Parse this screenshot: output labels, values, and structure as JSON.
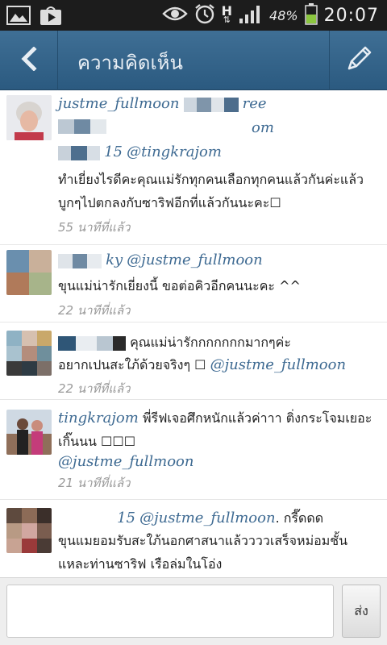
{
  "status_bar": {
    "network_type": "H",
    "battery_percent": "48%",
    "time": "20:07",
    "icons": [
      "gallery-icon",
      "play-store-icon",
      "eye-icon",
      "alarm-icon",
      "signal-icon",
      "battery-icon"
    ]
  },
  "action_bar": {
    "title": "ความคิดเห็น",
    "back_icon": "chevron-left-icon",
    "edit_icon": "pencil-icon"
  },
  "comments": [
    {
      "username": "justme_fullmoon",
      "username_tail": "ree",
      "line2_tail": "om",
      "mention_prefix": "15",
      "mention": "@tingkrajom",
      "text": "ทำเยี่ยงไรดีคะคุณแม่รักทุกคนเลือกทุกคนแล้วกันค่ะแล้วบูกๆไปตกลงกับซาริฟอีกที่แล้วกันนะคะ☐",
      "time": "55 นาทีที่แล้ว"
    },
    {
      "username_tail": "ky",
      "mention": "@justme_fullmoon",
      "text": "ขุนแม่น่ารักเยี่ยงนี้ ขอต่อคิวอีกคนนะคะ ^^",
      "time": "22 นาทีที่แล้ว"
    },
    {
      "text_line1": "คุณแม่น่ารักกกกกกกมากๆค่ะ",
      "text_line2": "อยากเปนสะใภ้ด้วยจริงๆ ☐",
      "mention": "@justme_fullmoon",
      "time": "22 นาทีที่แล้ว"
    },
    {
      "username": "tingkrajom",
      "text": "พี่รีฟเจอศึกหนักแล้วค่าาา ติ่งกระโจมเยอะเกิ๊นนน ☐☐☐",
      "mention": "@justme_fullmoon",
      "time": "21 นาทีที่แล้ว"
    },
    {
      "mention_prefix": "15",
      "mention": "@justme_fullmoon",
      "text_after_mention": ". กรี๊ดดด",
      "text": "ขุนแมยอมรับสะใภ้นอกศาสนาแล้ววววเสร็จหม่อมชั้นแหละท่านซาริฟ  เรือล่มในโอ่ง"
    }
  ],
  "composer": {
    "placeholder": "",
    "send_label": "ส่ง"
  }
}
